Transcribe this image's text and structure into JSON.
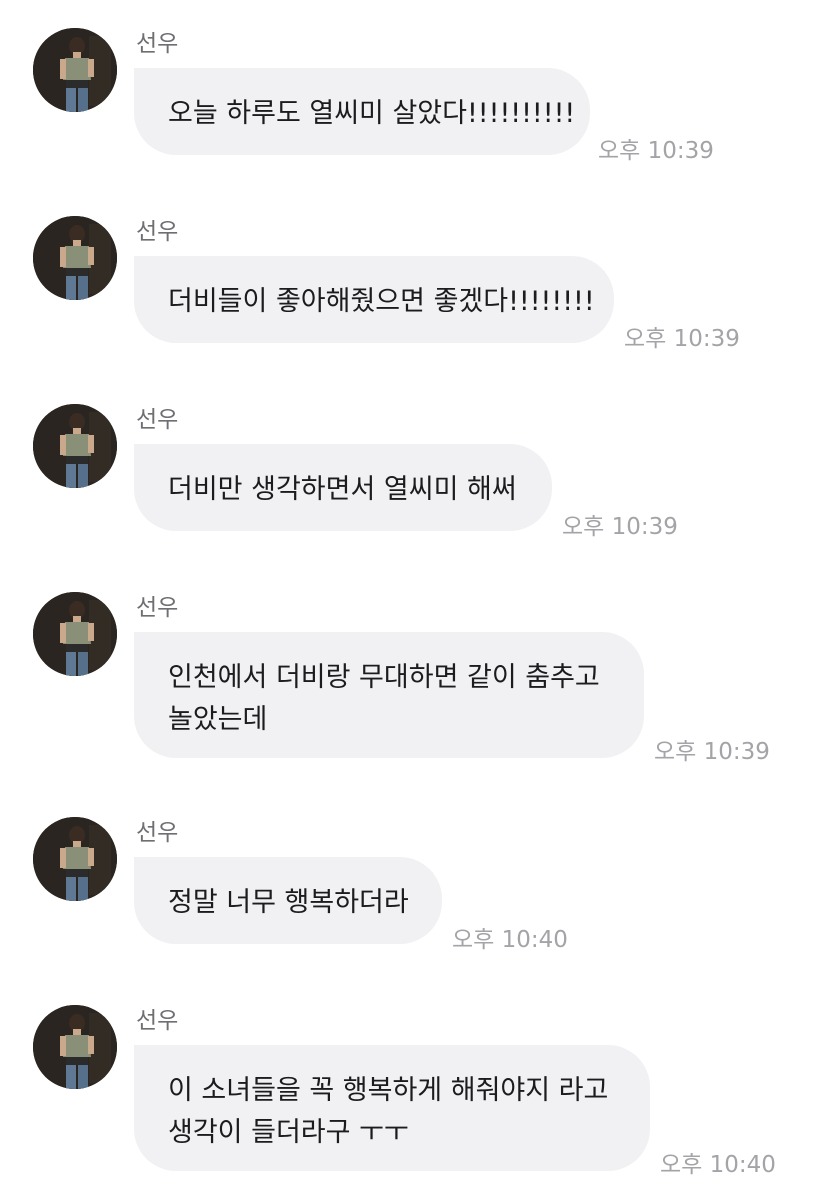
{
  "messages": [
    {
      "sender": "선우",
      "lines": [
        "오늘 하루도 열씨미 살았다!!!!!!!!!!"
      ],
      "time": "오후 10:39"
    },
    {
      "sender": "선우",
      "lines": [
        "더비들이 좋아해줬으면 좋겠다!!!!!!!!"
      ],
      "time": "오후 10:39"
    },
    {
      "sender": "선우",
      "lines": [
        "더비만 생각하면서 열씨미 해써"
      ],
      "time": "오후 10:39"
    },
    {
      "sender": "선우",
      "lines": [
        "인천에서 더비랑 무대하면 같이 춤추고",
        "놀았는데"
      ],
      "time": "오후 10:39"
    },
    {
      "sender": "선우",
      "lines": [
        "정말 너무 행복하더라"
      ],
      "time": "오후 10:40"
    },
    {
      "sender": "선우",
      "lines": [
        "이 소녀들을 꼭 행복하게 해줘야지 라고",
        "생각이 들더라구 ㅜㅜ"
      ],
      "time": "오후 10:40"
    }
  ],
  "icons": {
    "avatar": "profile-photo-icon"
  },
  "colors": {
    "bubble": "#f1f1f4",
    "sender": "#6e6e73",
    "time": "#a3a3a8",
    "text": "#1c1c1e"
  }
}
